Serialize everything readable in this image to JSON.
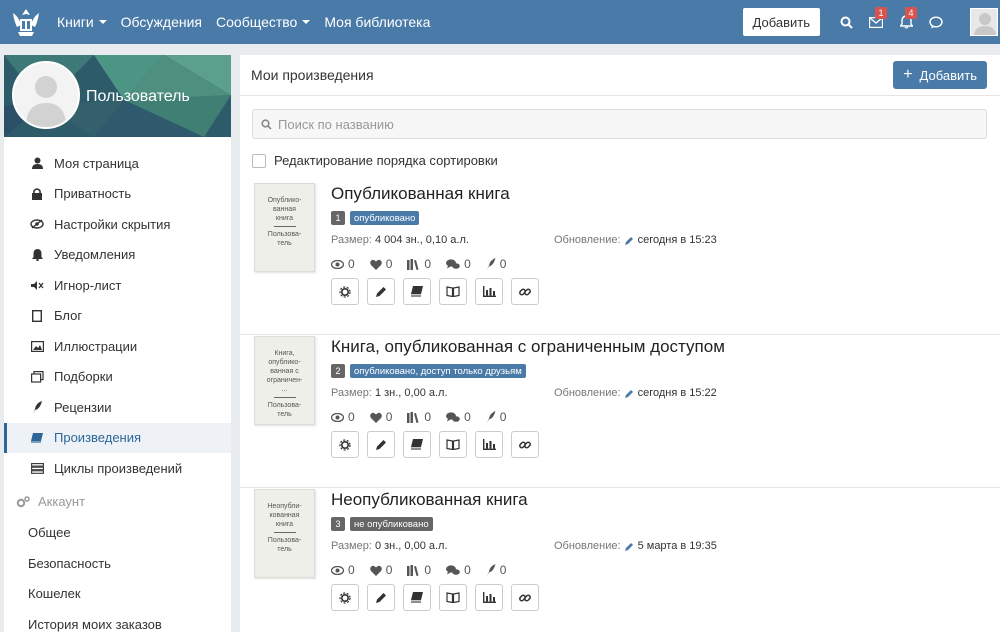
{
  "navbar": {
    "items": [
      {
        "label": "Книги",
        "has_caret": true
      },
      {
        "label": "Обсуждения",
        "has_caret": false
      },
      {
        "label": "Сообщество",
        "has_caret": true
      },
      {
        "label": "Моя библиотека",
        "has_caret": false
      }
    ],
    "add_label": "Добавить",
    "messages_badge": "1",
    "notifications_badge": "4",
    "icons": [
      "search-icon",
      "envelope-icon",
      "bell-icon",
      "chat-icon"
    ]
  },
  "sidebar": {
    "profile_name": "Пользователь",
    "items": [
      {
        "label": "Моя страница",
        "icon": "user-icon"
      },
      {
        "label": "Приватность",
        "icon": "lock-icon"
      },
      {
        "label": "Настройки скрытия",
        "icon": "eye-slash-icon"
      },
      {
        "label": "Уведомления",
        "icon": "bell-icon"
      },
      {
        "label": "Игнор-лист",
        "icon": "mute-icon"
      },
      {
        "label": "Блог",
        "icon": "file-icon"
      },
      {
        "label": "Иллюстрации",
        "icon": "image-icon"
      },
      {
        "label": "Подборки",
        "icon": "collection-icon"
      },
      {
        "label": "Рецензии",
        "icon": "quill-icon"
      },
      {
        "label": "Произведения",
        "icon": "book-icon",
        "active": true
      },
      {
        "label": "Циклы произведений",
        "icon": "stack-icon"
      }
    ],
    "account_section": "Аккаунт",
    "account_items": [
      "Общее",
      "Безопасность",
      "Кошелек",
      "История моих заказов"
    ]
  },
  "main": {
    "title": "Мои произведения",
    "add_label": "Добавить",
    "search_placeholder": "Поиск по названию",
    "sort_label": "Редактирование порядка сортировки",
    "size_label": "Размер:",
    "update_label": "Обновление:",
    "books": [
      {
        "num": "1",
        "title": "Опубликованная книга",
        "status": "опубликовано",
        "status_color": "#4a7aa8",
        "size": "4 004 зн., 0,10 а.л.",
        "updated": "сегодня в 15:23",
        "cover_title": [
          "Опублико-",
          "ванная",
          "книга"
        ],
        "cover_author": [
          "Пользова-",
          "тель"
        ],
        "stats": {
          "views": "0",
          "likes": "0",
          "libraries": "0",
          "comments": "0",
          "reviews": "0"
        }
      },
      {
        "num": "2",
        "title": "Книга, опубликованная с ограниченным доступом",
        "status": "опубликовано, доступ только друзьям",
        "status_color": "#4a7aa8",
        "size": "1 зн., 0,00 а.л.",
        "updated": "сегодня в 15:22",
        "cover_title": [
          "Книга,",
          "опублико-",
          "ванная с",
          "ограничен-",
          "..."
        ],
        "cover_author": [
          "Пользова-",
          "тель"
        ],
        "stats": {
          "views": "0",
          "likes": "0",
          "libraries": "0",
          "comments": "0",
          "reviews": "0"
        }
      },
      {
        "num": "3",
        "title": "Неопубликованная книга",
        "status": "не опубликовано",
        "status_color": "#666666",
        "size": "0 зн., 0,00 а.л.",
        "updated": "5 марта в 19:35",
        "cover_title": [
          "Неопубли-",
          "кованная",
          "книга"
        ],
        "cover_author": [
          "Пользова-",
          "тель"
        ],
        "stats": {
          "views": "0",
          "likes": "0",
          "libraries": "0",
          "comments": "0",
          "reviews": "0"
        }
      }
    ],
    "action_icons": [
      "settings-icon",
      "pencil-icon",
      "book-icon",
      "read-icon",
      "stats-icon",
      "link-icon"
    ]
  }
}
